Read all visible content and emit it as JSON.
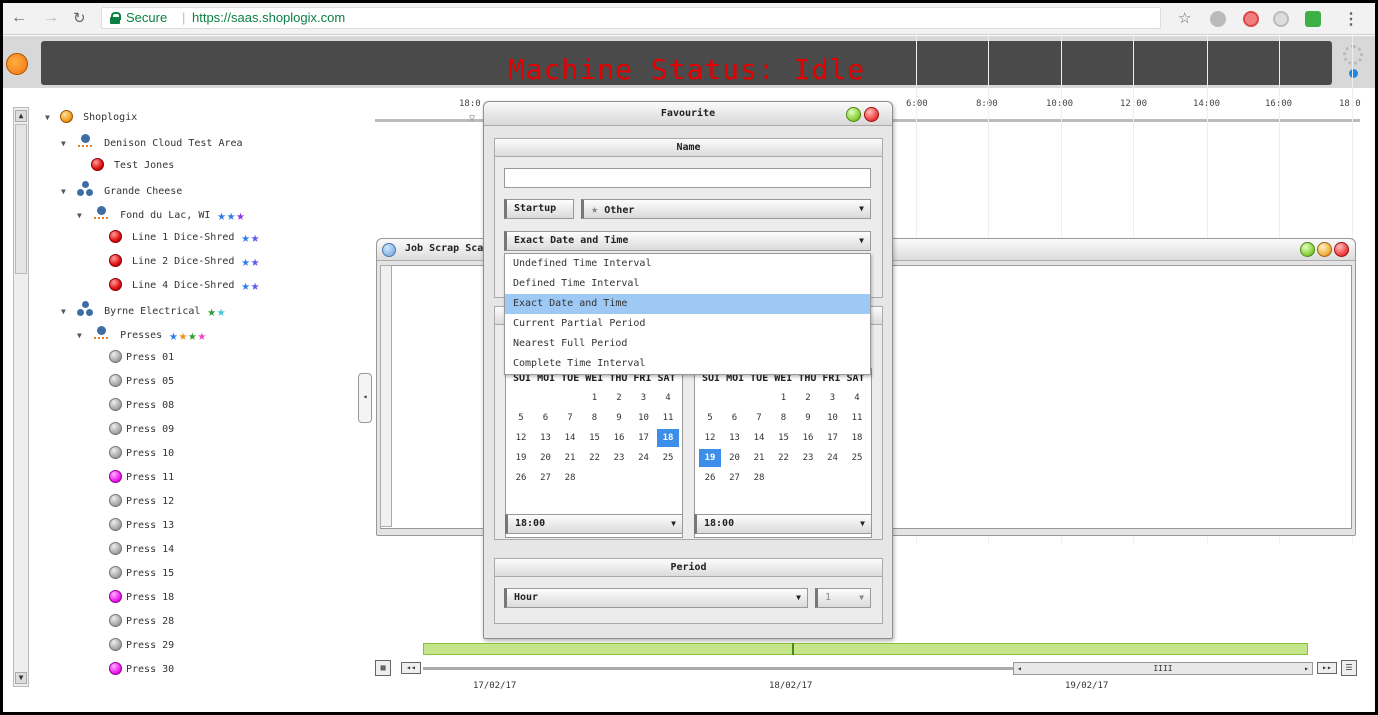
{
  "browser": {
    "secure_label": "Secure",
    "separator": "|",
    "url": "https://saas.shoplogix.com"
  },
  "header": {
    "title": "Machine Status: Idle"
  },
  "tree": {
    "root": "Shoplogix",
    "denison": "Denison Cloud Test Area",
    "test_jones": "Test Jones",
    "grande": "Grande Cheese",
    "fond": "Fond du Lac, WI",
    "line1": "Line 1 Dice-Shred",
    "line2": "Line 2 Dice-Shred",
    "line4": "Line 4 Dice-Shred",
    "byrne": "Byrne Electrical",
    "presses": "Presses",
    "press_items": [
      "Press 01",
      "Press 05",
      "Press 08",
      "Press 09",
      "Press 10",
      "Press 11",
      "Press 12",
      "Press 13",
      "Press 14",
      "Press 15",
      "Press 18",
      "Press 28",
      "Press 29",
      "Press 30"
    ]
  },
  "timeline": {
    "ticks": [
      "18:0",
      "6:00",
      "8:00",
      "10:00",
      "12:00",
      "14:00",
      "16:00",
      "18:0"
    ],
    "dates": [
      "17/02/17",
      "18/02/17",
      "19/02/17"
    ]
  },
  "job_window": {
    "title": "Job Scrap Sca"
  },
  "favourite": {
    "title": "Favourite",
    "name_header": "Name",
    "name_value": "",
    "startup_label": "Startup",
    "other_label": "Other",
    "interval_selected": "Exact Date and Time",
    "interval_options": [
      "Undefined Time Interval",
      "Defined Time Interval",
      "Exact Date and Time",
      "Current Partial Period",
      "Nearest Full Period",
      "Complete Time Interval"
    ],
    "day_headers": [
      "SUN",
      "MON",
      "TUE",
      "WED",
      "THU",
      "FRI",
      "SAT"
    ],
    "day_headers_shown": "SUI MOI TUE WEI THU FRI SAT",
    "cal_weeks": [
      [
        "",
        "",
        "",
        "1",
        "2",
        "3",
        "4"
      ],
      [
        "5",
        "6",
        "7",
        "8",
        "9",
        "10",
        "11"
      ],
      [
        "12",
        "13",
        "14",
        "15",
        "16",
        "17",
        "18"
      ],
      [
        "19",
        "20",
        "21",
        "22",
        "23",
        "24",
        "25"
      ],
      [
        "26",
        "27",
        "28",
        "",
        "",
        "",
        ""
      ]
    ],
    "left_selected_day": "18",
    "right_selected_day": "19",
    "left_time": "18:00",
    "right_time": "18:00",
    "period_header": "Period",
    "period_value": "Hour",
    "period_count": "1"
  },
  "scroll": {
    "thumb_label": "IIII",
    "first": "◂◂",
    "last": "▸▸"
  },
  "colors": {
    "title_red": "#e50000",
    "selected_blue": "#3d8ee8",
    "option_highlight": "#9ec9f5",
    "timeline_green": "#c5e58a"
  }
}
